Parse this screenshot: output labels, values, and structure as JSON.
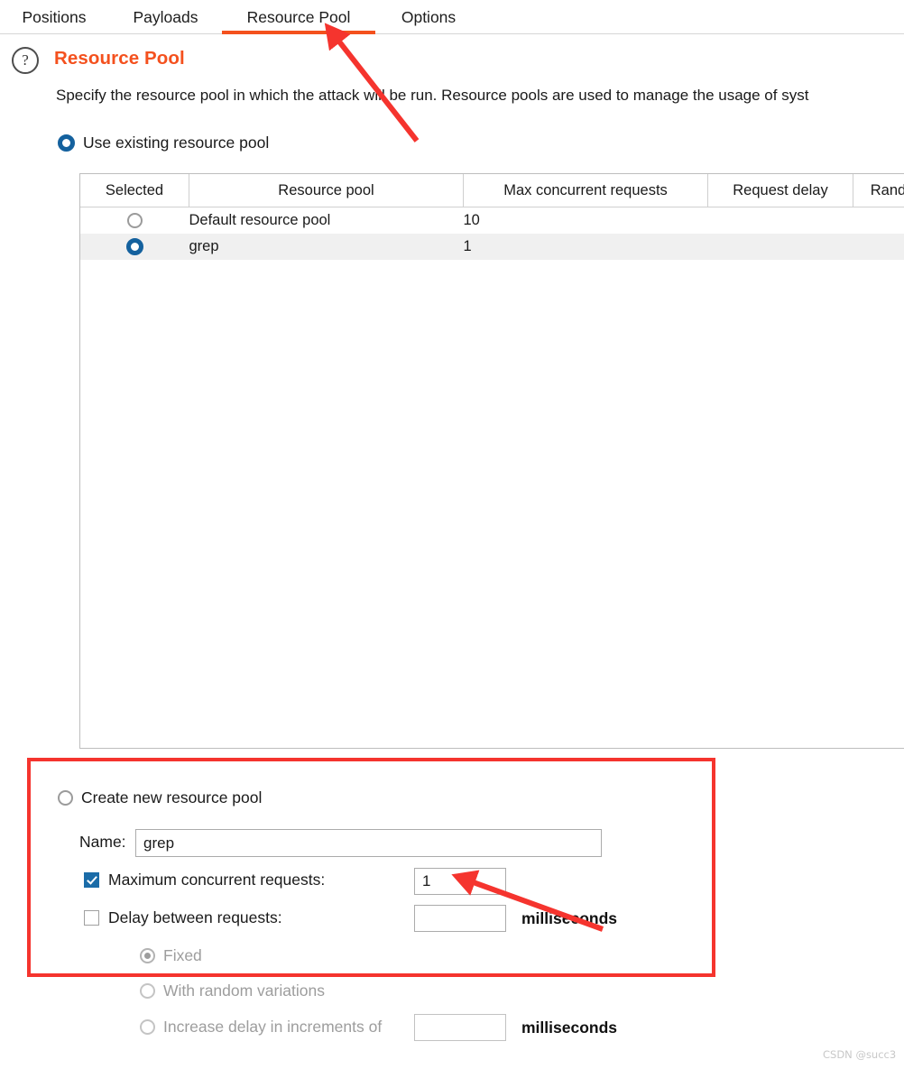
{
  "tabs": [
    {
      "id": "positions",
      "label": "Positions",
      "active": false
    },
    {
      "id": "payloads",
      "label": "Payloads",
      "active": false
    },
    {
      "id": "respool",
      "label": "Resource Pool",
      "active": true
    },
    {
      "id": "options",
      "label": "Options",
      "active": false
    }
  ],
  "panel": {
    "help_icon": "?",
    "title": "Resource Pool",
    "description": "Specify the resource pool in which the attack will be run. Resource pools are used to manage the usage of syst"
  },
  "use_existing": {
    "label": "Use existing resource pool",
    "selected": true
  },
  "table": {
    "headers": [
      "Selected",
      "Resource pool",
      "Max concurrent requests",
      "Request delay",
      "Rand"
    ],
    "rows": [
      {
        "selected": false,
        "resource_pool": "Default resource pool",
        "max_concurrent_requests": "10",
        "request_delay": "",
        "rand": ""
      },
      {
        "selected": true,
        "resource_pool": "grep",
        "max_concurrent_requests": "1",
        "request_delay": "",
        "rand": ""
      }
    ]
  },
  "create_new": {
    "label": "Create new resource pool",
    "selected": false,
    "name_label": "Name:",
    "name_value": "grep",
    "max_concurrent": {
      "label": "Maximum concurrent requests:",
      "checked": true,
      "value": "1"
    },
    "delay_between": {
      "label": "Delay between requests:",
      "checked": false,
      "value": "",
      "unit": "milliseconds"
    },
    "delay_mode": {
      "fixed_label": "Fixed",
      "fixed_selected": true,
      "random_label": "With random variations",
      "random_selected": false,
      "increase_label": "Increase delay in increments of",
      "increase_selected": false,
      "increase_value": "",
      "increase_unit": "milliseconds"
    }
  },
  "annotations": {
    "highlight_color": "#f5342e",
    "arrow_color": "#f5342e",
    "accent_color": "#f4511e",
    "selection_blue": "#14619e"
  },
  "watermark": "CSDN @succ3"
}
